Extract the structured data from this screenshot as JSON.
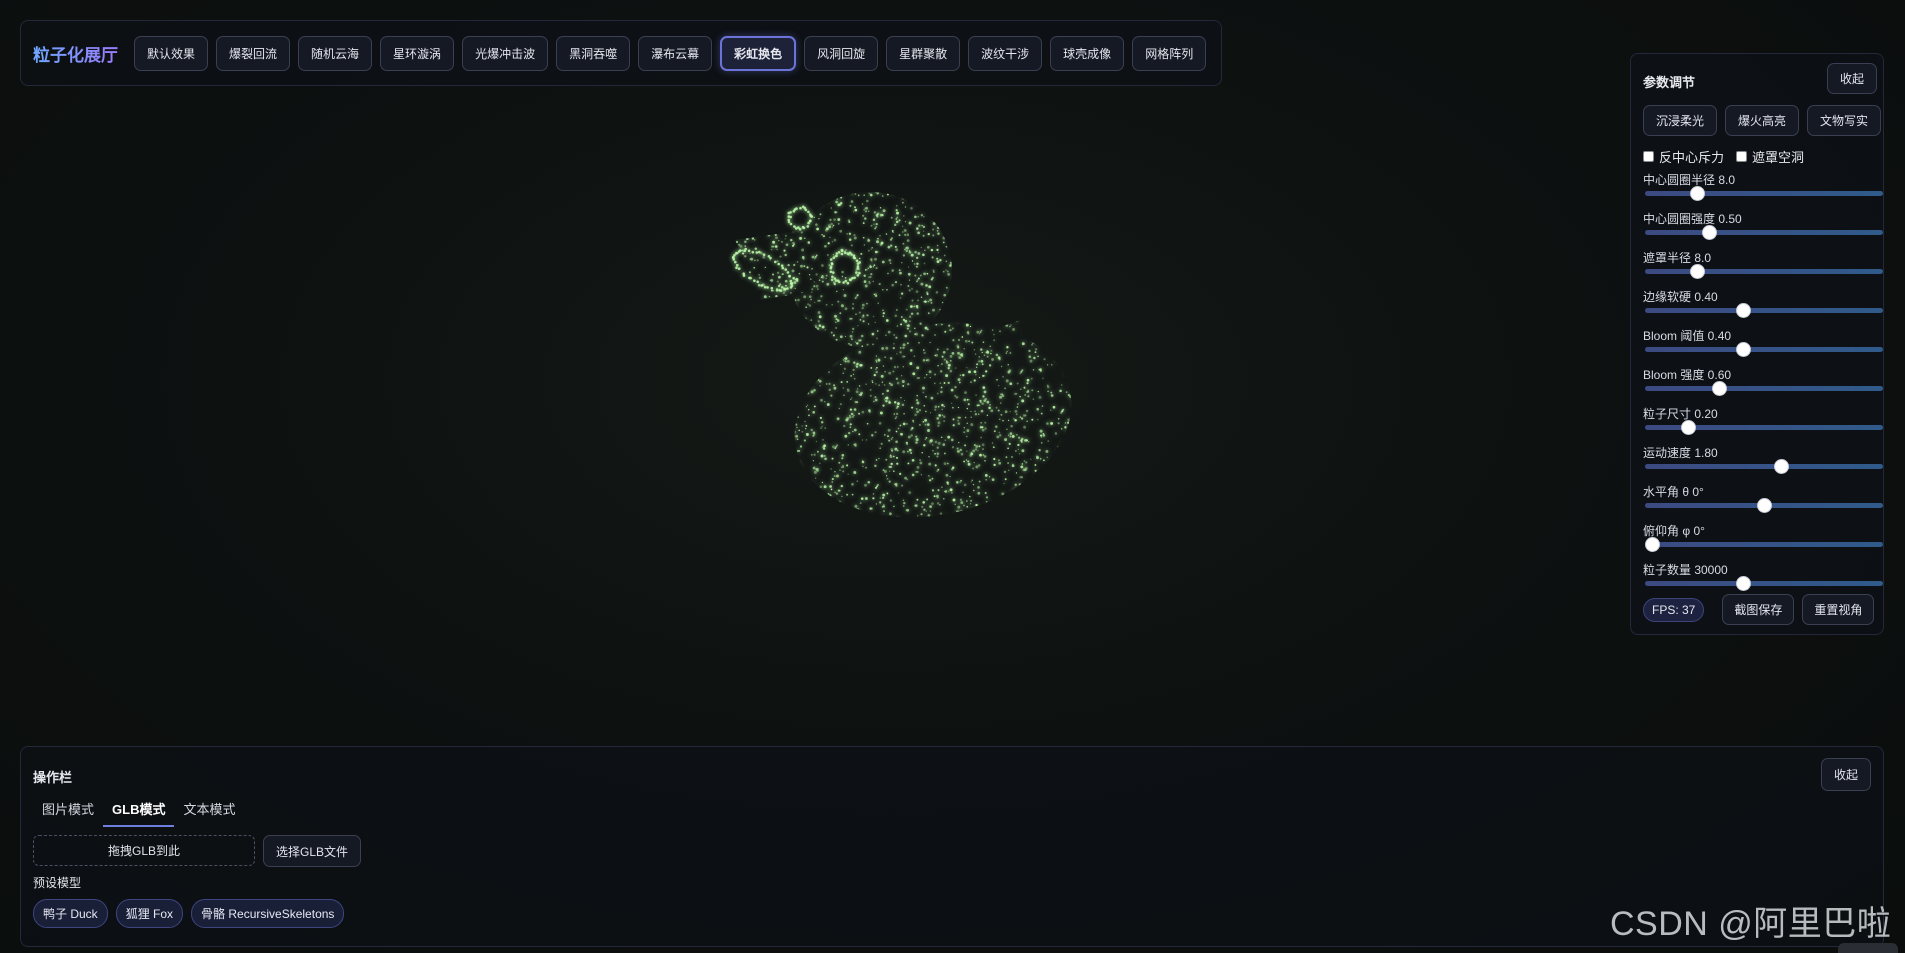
{
  "header": {
    "brand": "粒子化展厅",
    "effects": [
      {
        "label": "默认效果",
        "active": false
      },
      {
        "label": "爆裂回流",
        "active": false
      },
      {
        "label": "随机云海",
        "active": false
      },
      {
        "label": "星环漩涡",
        "active": false
      },
      {
        "label": "光爆冲击波",
        "active": false
      },
      {
        "label": "黑洞吞噬",
        "active": false
      },
      {
        "label": "瀑布云幕",
        "active": false
      },
      {
        "label": "彩虹换色",
        "active": true
      },
      {
        "label": "风洞回旋",
        "active": false
      },
      {
        "label": "星群聚散",
        "active": false
      },
      {
        "label": "波纹干涉",
        "active": false
      },
      {
        "label": "球壳成像",
        "active": false
      },
      {
        "label": "网格阵列",
        "active": false
      }
    ]
  },
  "scene": {
    "object": "rubber duck particle cloud",
    "particle_color": "#b8f7a6"
  },
  "params": {
    "title": "参数调节",
    "collapse_label": "收起",
    "presets": [
      "沉浸柔光",
      "爆火高亮",
      "文物写实"
    ],
    "checkboxes": [
      {
        "label": "反中心斥力",
        "checked": false
      },
      {
        "label": "遮罩空洞",
        "checked": false
      }
    ],
    "sliders": [
      {
        "label": "中心圆圈半径 8.0",
        "level": 0.22
      },
      {
        "label": "中心圆圈强度 0.50",
        "level": 0.27
      },
      {
        "label": "遮罩半径 8.0",
        "level": 0.22
      },
      {
        "label": "边缘软硬 0.40",
        "level": 0.41
      },
      {
        "label": "Bloom 阈值 0.40",
        "level": 0.41
      },
      {
        "label": "Bloom 强度 0.60",
        "level": 0.31
      },
      {
        "label": "粒子尺寸 0.20",
        "level": 0.18
      },
      {
        "label": "运动速度 1.80",
        "level": 0.57
      },
      {
        "label": "水平角 θ 0°",
        "level": 0.5
      },
      {
        "label": "俯仰角 φ 0°",
        "level": 0.03
      },
      {
        "label": "粒子数量 30000",
        "level": 0.41
      }
    ],
    "fps": "FPS: 37",
    "screenshot_label": "截图保存",
    "reset_label": "重置视角"
  },
  "ops": {
    "title": "操作栏",
    "collapse_label": "收起",
    "tabs": [
      {
        "label": "图片模式",
        "active": false
      },
      {
        "label": "GLB模式",
        "active": true
      },
      {
        "label": "文本模式",
        "active": false
      }
    ],
    "drop_text": "拖拽GLB到此",
    "choose_label": "选择GLB文件",
    "preset_models_label": "预设模型",
    "models": [
      "鸭子 Duck",
      "狐狸 Fox",
      "骨骼 RecursiveSkeletons"
    ]
  },
  "watermark": "CSDN @阿里巴啦"
}
